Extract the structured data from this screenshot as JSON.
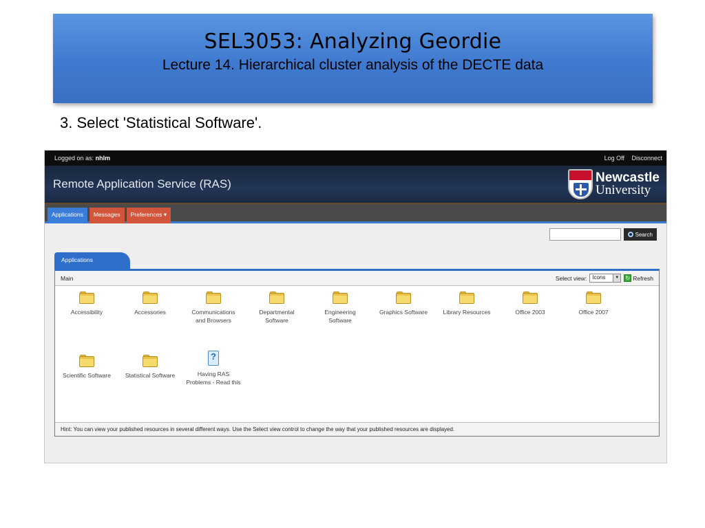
{
  "slide": {
    "title": "SEL3053: Analyzing Geordie",
    "subtitle": "Lecture 14. Hierarchical cluster analysis of the DECTE data",
    "step": "3. Select 'Statistical Software'."
  },
  "ras": {
    "logged_on_label": "Logged on as:",
    "logged_on_user": "nhlm",
    "logoff": "Log Off",
    "disconnect": "Disconnect",
    "app_title": "Remote Application Service (RAS)",
    "logo_line1": "Newcastle",
    "logo_line2": "University",
    "tabs": [
      "Applications",
      "Messages",
      "Preferences ▾"
    ],
    "search_label": "Search",
    "panel_tab": "Applications",
    "breadcrumb": "Main",
    "select_view_label": "Select view:",
    "select_view_value": "Icons",
    "refresh_label": "Refresh",
    "items": [
      {
        "line1": "Accessibility",
        "line2": ""
      },
      {
        "line1": "Accessories",
        "line2": ""
      },
      {
        "line1": "Communications",
        "line2": "and Browsers"
      },
      {
        "line1": "Departmental",
        "line2": "Software"
      },
      {
        "line1": "Engineering",
        "line2": "Software"
      },
      {
        "line1": "Graphics Software",
        "line2": ""
      },
      {
        "line1": "Library Resources",
        "line2": ""
      },
      {
        "line1": "Office 2003",
        "line2": ""
      },
      {
        "line1": "Office 2007",
        "line2": ""
      },
      {
        "line1": "Scientific Software",
        "line2": ""
      },
      {
        "line1": "Statistical Software",
        "line2": ""
      },
      {
        "line1": "Having RAS",
        "line2": "Problems - Read this"
      }
    ],
    "hint": "Hint: You can view your published resources in several different ways. Use the Select view control to change the way that your published resources are displayed."
  }
}
